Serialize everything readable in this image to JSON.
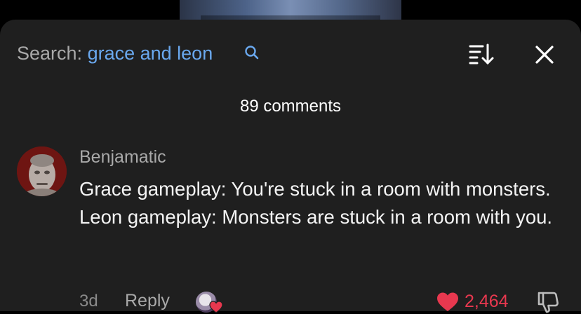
{
  "search": {
    "label": "Search:",
    "query": "grace and leon"
  },
  "header": {
    "comment_count": "89 comments"
  },
  "comment": {
    "username": "Benjamatic",
    "text": "Grace gameplay: You're stuck in a room with monsters. Leon gameplay: Monsters are stuck in a room with you.",
    "time": "3d",
    "reply_label": "Reply",
    "like_count": "2,464"
  },
  "colors": {
    "sheet_bg": "#1f1f1f",
    "search_term": "#6aa8ee",
    "like": "#e8384f"
  },
  "icons": [
    "search-icon",
    "sort-icon",
    "close-icon",
    "heart-icon",
    "dislike-icon"
  ]
}
